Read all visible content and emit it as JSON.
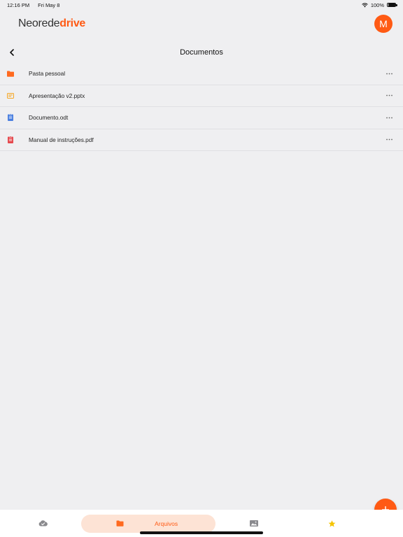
{
  "status_bar": {
    "time": "12:16 PM",
    "date": "Fri May 8",
    "battery": "100%"
  },
  "header": {
    "logo_light": "Neorede",
    "logo_bold": "drive",
    "avatar_initial": "M",
    "brand_color": "#ff5a14"
  },
  "nav": {
    "title": "Documentos",
    "back_icon": "chevron-left-icon"
  },
  "files": [
    {
      "name": "Pasta pessoal",
      "icon": "folder-icon",
      "color": "#ff6a1f"
    },
    {
      "name": "Apresentação v2.pptx",
      "icon": "presentation-icon",
      "color": "#f5a623"
    },
    {
      "name": "Documento.odt",
      "icon": "document-icon",
      "color": "#4a7fe0"
    },
    {
      "name": "Manual de instruções.pdf",
      "icon": "pdf-icon",
      "color": "#e5484d"
    }
  ],
  "more_icon": "more-horizontal-icon",
  "fab_icon": "plus-icon",
  "tabs": [
    {
      "icon": "cloud-check-icon",
      "label": ""
    },
    {
      "icon": "folder-icon",
      "label": "Arquivos",
      "active": true
    },
    {
      "icon": "image-icon",
      "label": ""
    },
    {
      "icon": "star-icon",
      "label": ""
    }
  ]
}
